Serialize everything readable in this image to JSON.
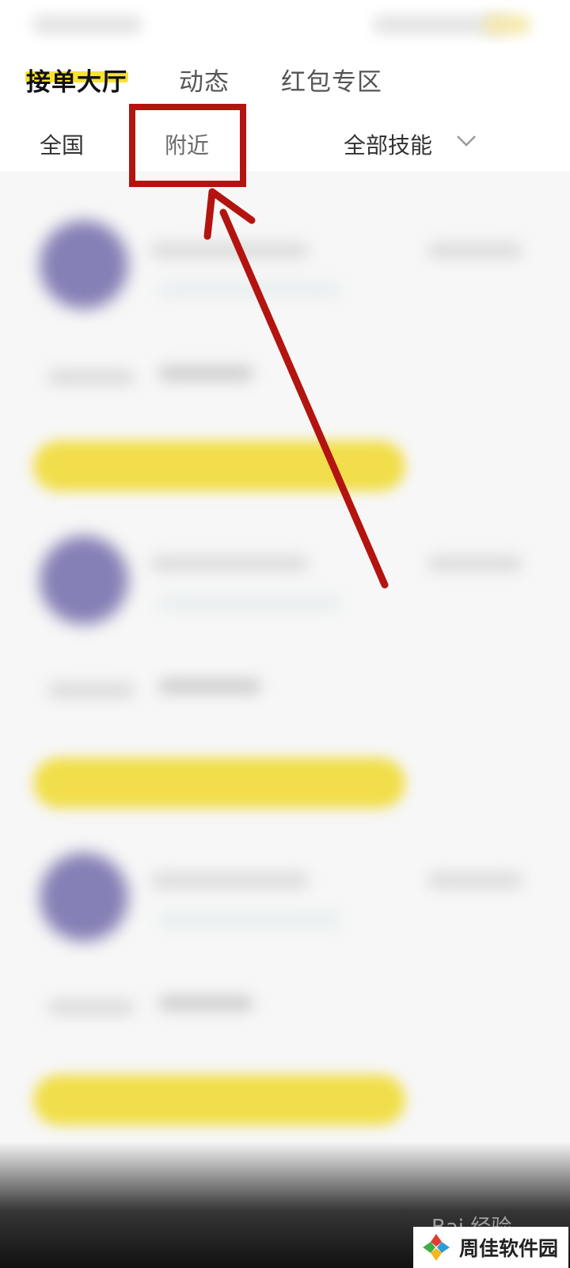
{
  "tabs": [
    {
      "label": "接单大厅",
      "active": true
    },
    {
      "label": "动态",
      "active": false
    },
    {
      "label": "红包专区",
      "active": false
    }
  ],
  "filters": {
    "nationwide": "全国",
    "nearby": "附近",
    "skills": "全部技能"
  },
  "watermark": {
    "baidu": "Bai 经验",
    "site": "周佳软件园"
  },
  "colors": {
    "accent_yellow": "#f8e233",
    "annotation_red": "#b3140f"
  }
}
